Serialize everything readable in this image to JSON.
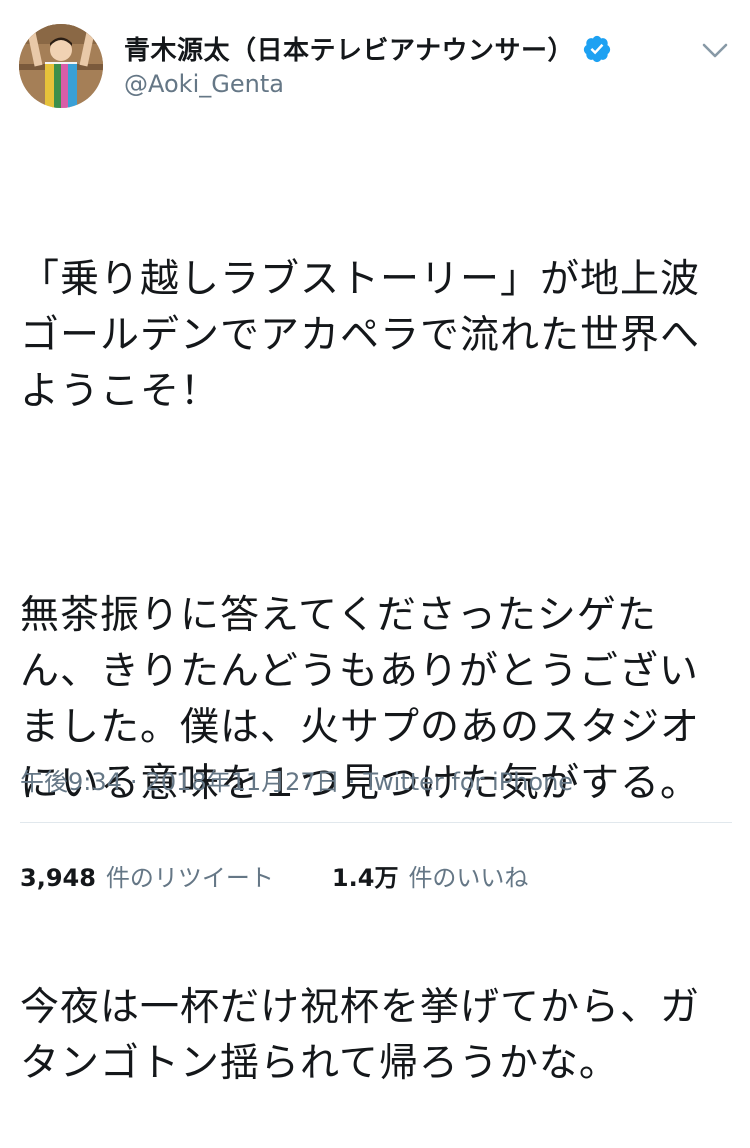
{
  "user": {
    "display_name": "青木源太（日本テレビアナウンサー）",
    "handle": "@Aoki_Genta",
    "verified_color": "#1da1f2"
  },
  "tweet": {
    "paragraphs": [
      "「乗り越しラブストーリー」が地上波ゴールデンでアカペラで流れた世界へようこそ！",
      "無茶振りに答えてくださったシゲたん、きりたんどうもありがとうございました。僕は、火サプのあのスタジオにいる意味を１つ見つけた気がする。",
      "今夜は一杯だけ祝杯を挙げてから、ガタンゴトン揺られて帰ろうかな。"
    ],
    "time": "午後9:34",
    "date": "2018年11月27日",
    "source": "Twitter for iPhone"
  },
  "stats": {
    "retweets_count": "3,948",
    "retweets_label": "件のリツイート",
    "likes_count": "1.4万",
    "likes_label": "件のいいね"
  },
  "icons": {
    "verified": "verified-badge-icon",
    "caret": "chevron-down-icon"
  }
}
